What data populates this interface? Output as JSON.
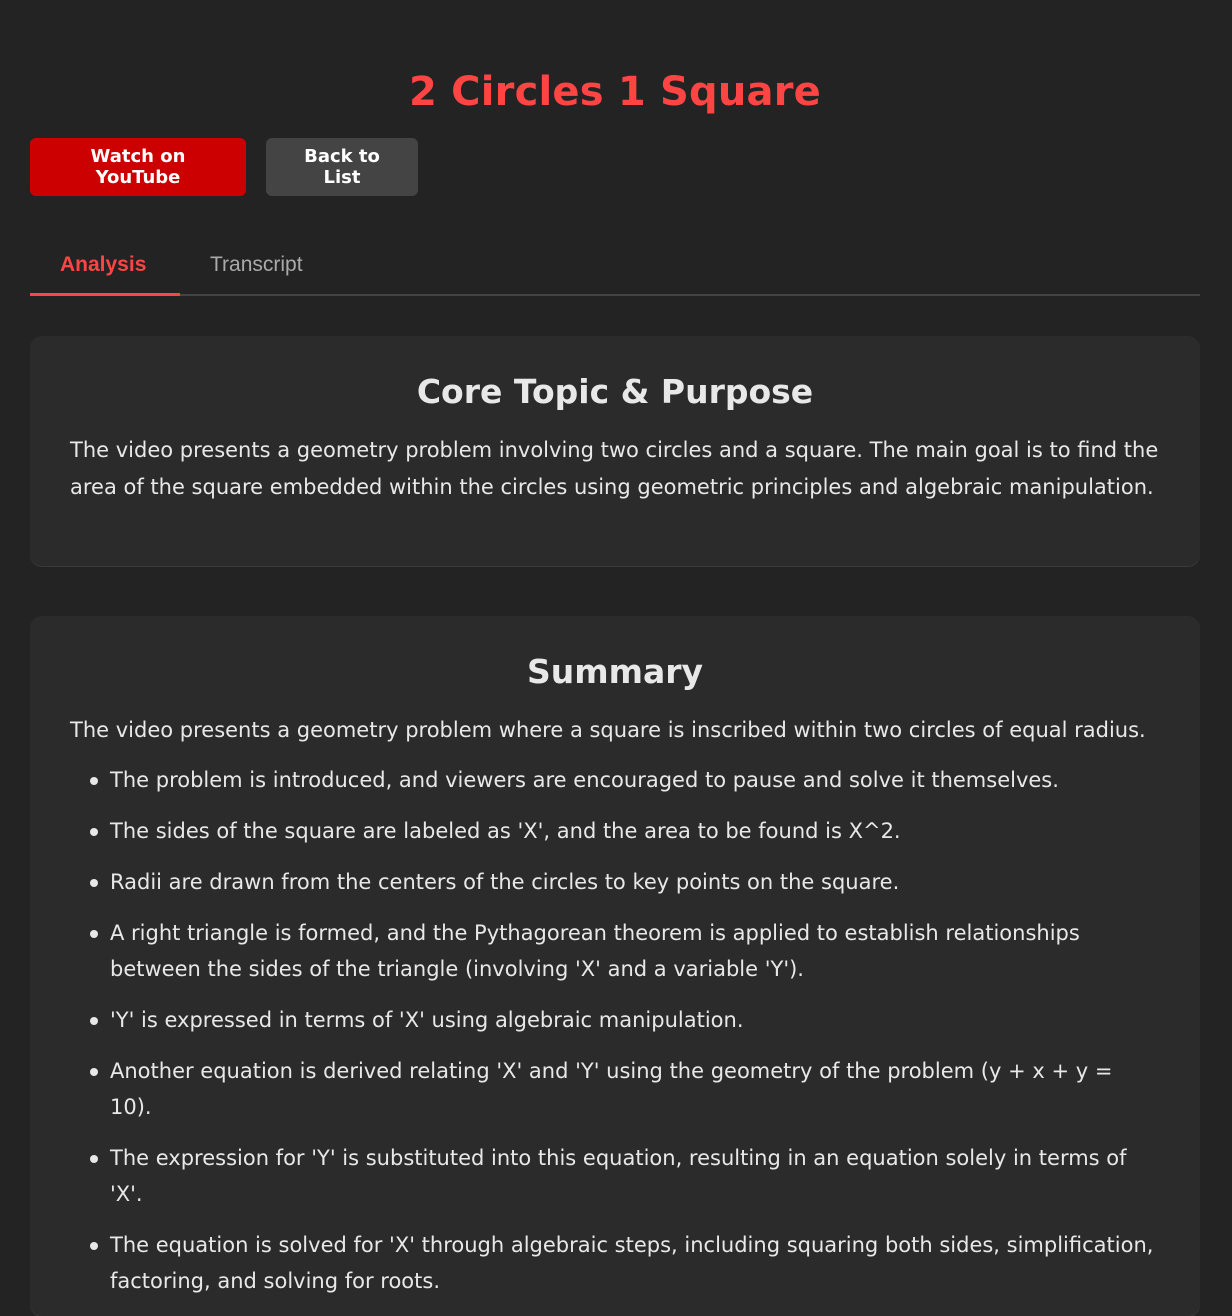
{
  "header": {
    "title": "2 Circles 1 Square"
  },
  "actions": {
    "youtube_label": "Watch on YouTube",
    "back_label": "Back to List"
  },
  "tabs": [
    {
      "label": "Analysis",
      "active": true
    },
    {
      "label": "Transcript",
      "active": false
    }
  ],
  "sections": {
    "core": {
      "heading": "Core Topic & Purpose",
      "text": "The video presents a geometry problem involving two circles and a square. The main goal is to find the area of the square embedded within the circles using geometric principles and algebraic manipulation."
    },
    "summary": {
      "heading": "Summary",
      "intro": "The video presents a geometry problem where a square is inscribed within two circles of equal radius.",
      "points": [
        "The problem is introduced, and viewers are encouraged to pause and solve it themselves.",
        "The sides of the square are labeled as 'X', and the area to be found is X^2.",
        "Radii are drawn from the centers of the circles to key points on the square.",
        "A right triangle is formed, and the Pythagorean theorem is applied to establish relationships between the sides of the triangle (involving 'X' and a variable 'Y').",
        "'Y' is expressed in terms of 'X' using algebraic manipulation.",
        "Another equation is derived relating 'X' and 'Y' using the geometry of the problem (y + x + y = 10).",
        "The expression for 'Y' is substituted into this equation, resulting in an equation solely in terms of 'X'.",
        "The equation is solved for 'X' through algebraic steps, including squaring both sides, simplification, factoring, and solving for roots."
      ]
    }
  },
  "colors": {
    "accent": "#ff4444",
    "youtube_red": "#cc0000",
    "background": "#232323",
    "card": "#2b2b2b"
  }
}
